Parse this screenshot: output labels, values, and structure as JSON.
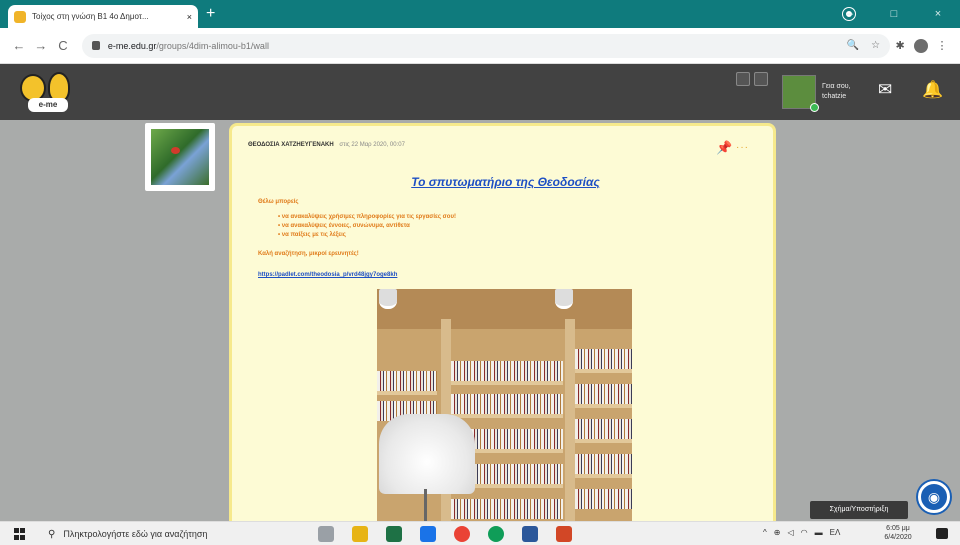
{
  "browser": {
    "tab_title": "Τοίχος στη γνώση Β1 4ο Δημοτ...",
    "tab_close": "×",
    "new_tab": "+",
    "url_host": "e-me.edu.gr",
    "url_path": "/groups/4dim-alimou-b1/wall",
    "window_controls": [
      "–",
      "□",
      "×"
    ]
  },
  "site": {
    "logo_text": "e-me",
    "user_name": "Γεια σου, tchatzie",
    "mail_icon": "✉",
    "bell_icon": "🔔"
  },
  "post": {
    "author": "ΘΕΟΔΟΣΙΑ ΧΑΤΖΗΕΥΓΕΝΑΚΗ",
    "date": "στις 22 Μαρ 2020, 00:07",
    "title": "Το σπυτωματήριο της Θεοδοσίας",
    "intro": "Θέλω μπορείς",
    "bullets": [
      "• να ανακαλύψεις χρήσιμες πληροφορίες για τις εργασίες σου!",
      "• να ανακαλύψεις έννοιες, συνώνυμα, αντίθετα",
      "• να παίξεις με τις λέξεις"
    ],
    "closing": "Καλή αναζήτηση, μικροί ερευνητές!",
    "link": "https://padlet.com/theodosia_p/vrd48jgy7oge8kh"
  },
  "accessibility": {
    "tooltip": "Σχήμα/Υποστήριξη",
    "button_glyph": "◉"
  },
  "taskbar": {
    "search_placeholder": "Πληκτρολογήστε εδώ για αναζήτηση",
    "language": "ΕΛ",
    "time": "6:05 μμ",
    "date": "6/4/2020"
  },
  "colors": {
    "titlebar": "#0f7b7d",
    "header": "#424242",
    "post_bg": "#fdfbd5",
    "post_border": "#f6e98c",
    "title_blue": "#1d4fc4",
    "text_orange": "#e07b1a"
  }
}
